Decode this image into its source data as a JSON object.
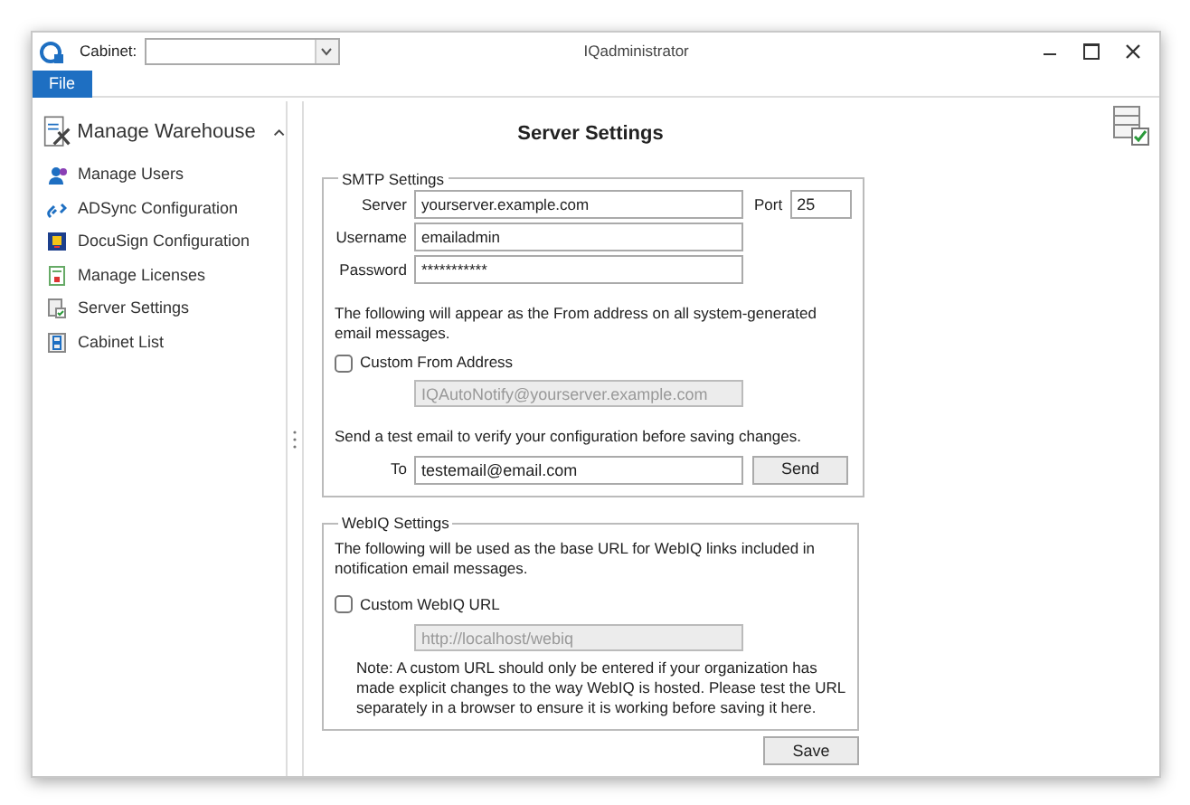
{
  "window": {
    "title": "IQadministrator"
  },
  "toolbar": {
    "cabinet_label": "Cabinet:"
  },
  "menu": [
    {
      "label": "File",
      "selected": true
    }
  ],
  "sidebar": {
    "header": "Manage Warehouse",
    "expanded": true,
    "items": [
      {
        "label": "Manage Users",
        "kind": "users"
      },
      {
        "label": "ADSync Configuration",
        "kind": "link"
      },
      {
        "label": "DocuSign Configuration",
        "kind": "docusign"
      },
      {
        "label": "Manage Licenses",
        "kind": "license"
      },
      {
        "label": "Server Settings",
        "kind": "server"
      },
      {
        "label": "Cabinet List",
        "kind": "cabinet"
      }
    ]
  },
  "main": {
    "title": "Server Settings",
    "smtp": {
      "legend": "SMTP Settings",
      "fields": [
        {
          "label": "Server",
          "value": "yourserver.example.com"
        },
        {
          "label": "Username",
          "value": "emailadmin"
        },
        {
          "label": "Password",
          "value": "***********"
        }
      ],
      "port_label": "Port",
      "port_value": "25",
      "from_note": "The following will appear as the From address on all system-generated email messages.",
      "custom_from": {
        "label": "Custom From Address",
        "checked": false
      },
      "from_placeholder": "IQAutoNotify@yourserver.example.com",
      "test_note": "Send a test email to verify your configuration before saving changes.",
      "to_label": "To",
      "to_value": "testemail@email.com",
      "send_button": "Send"
    },
    "webiq": {
      "legend": "WebIQ Settings",
      "url_note": "The following will be used as the base URL for WebIQ links included in notification email messages.",
      "custom_url": {
        "label": "Custom WebIQ URL",
        "checked": false
      },
      "url_placeholder": "http://localhost/webiq",
      "warning": "Note: A custom URL should only be entered if your organization has made explicit changes to the way WebIQ is hosted. Please test the URL separately in a browser to ensure it is working before saving it here."
    },
    "save_button": "Save"
  }
}
